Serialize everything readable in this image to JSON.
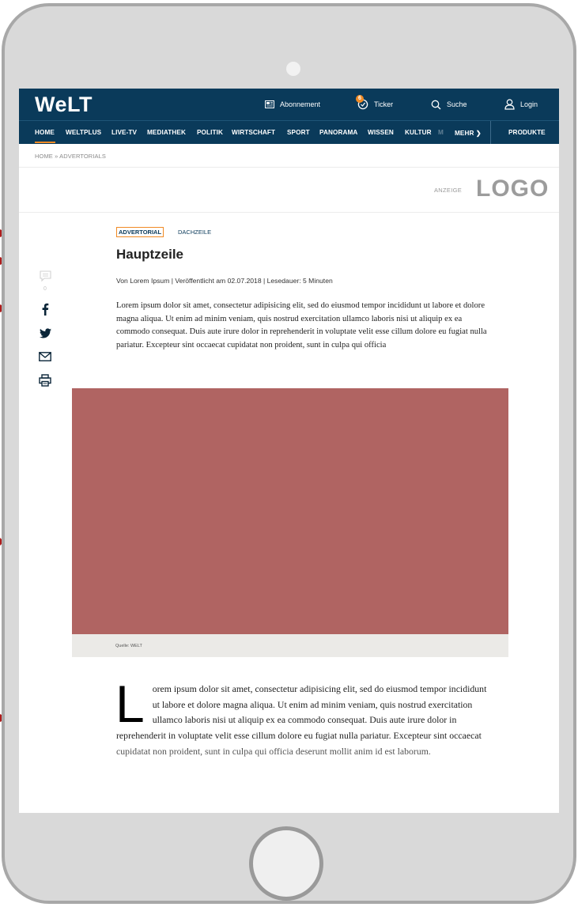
{
  "header": {
    "logo": "WeLT",
    "abonnement_label": "Abonnement",
    "ticker_label": "Ticker",
    "ticker_badge": "6",
    "suche_label": "Suche",
    "login_label": "Login"
  },
  "nav": {
    "items": [
      {
        "label": "HOME"
      },
      {
        "label": "WELTPLUS"
      },
      {
        "label": "LIVE-TV"
      },
      {
        "label": "MEDIATHEK"
      },
      {
        "label": "POLITIK"
      },
      {
        "label": "WIRTSCHAFT"
      },
      {
        "label": "SPORT"
      },
      {
        "label": "PANORAMA"
      },
      {
        "label": "WISSEN"
      },
      {
        "label": "KULTUR"
      },
      {
        "label": "M"
      }
    ],
    "more_label": "MEHR ❯",
    "produkte_label": "PRODUKTE",
    "active": "HOME"
  },
  "breadcrumb": "HOME » ADVERTORIALS",
  "ad": {
    "anzeige_label": "ANZEIGE",
    "logo": "LOGO"
  },
  "article": {
    "tag": "ADVERTORIAL",
    "dachzeile": "DACHZEILE",
    "headline": "Hauptzeile",
    "byline": "Von Lorem Ipsum | Veröffentlicht am 02.07.2018 | Lesedauer: 5 Minuten",
    "intro": "Lorem ipsum dolor sit amet, consectetur adipisicing elit, sed do eiusmod tempor incididunt ut labore et dolore magna aliqua. Ut enim ad minim veniam, quis nostrud exercitation ullamco laboris nisi ut aliquip ex ea commodo consequat. Duis aute irure dolor in reprehenderit in voluptate velit esse cillum dolore eu fugiat nulla pariatur. Excepteur sint occaecat cupidatat non proident, sunt in culpa qui officia",
    "comment_count": "0",
    "image_color": "#b06462",
    "image_caption": "Quelle: WELT",
    "dropcap": "L",
    "body": "orem ipsum dolor sit amet, consectetur adipisicing elit, sed do eiusmod tempor incididunt ut labore et dolore magna aliqua. Ut enim ad minim veniam, quis nostrud exercitation ullamco laboris nisi ut aliquip ex ea commodo consequat. Duis aute irure dolor in reprehen­derit in voluptate velit esse cillum dolore eu fugiat nulla pariatur. Excepteur sint occaecat cupidatat non proident, sunt in culpa qui officia deserunt mollit anim id est laborum."
  },
  "colors": {
    "brand_navy": "#0a3a5a",
    "accent_orange": "#f08a24",
    "annotation_arrow": "#b01c1c"
  }
}
